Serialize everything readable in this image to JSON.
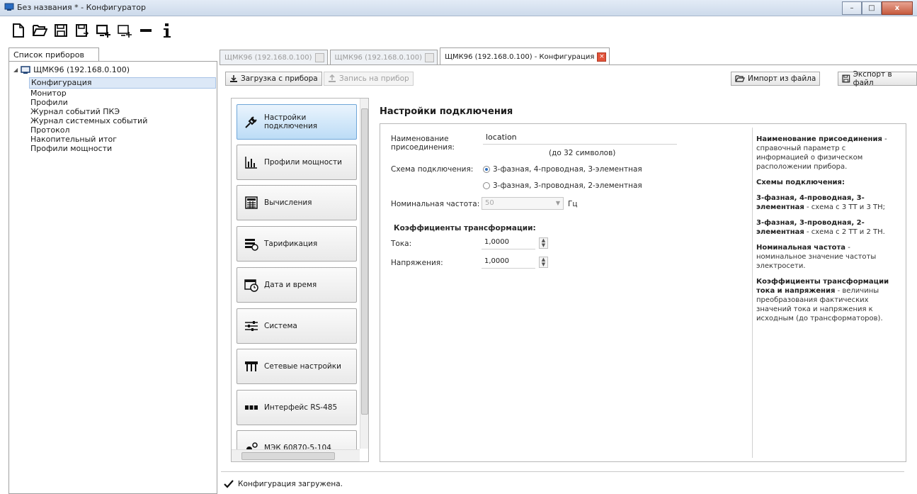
{
  "window": {
    "title": "Без названия * - Конфигуратор",
    "minimize": "–",
    "maximize": "□",
    "close": "x"
  },
  "toolbar": {
    "icons": [
      "new-file-icon",
      "open-folder-icon",
      "save-icon",
      "save-as-icon",
      "add-device-icon",
      "add-device-copy-icon",
      "remove-icon",
      "info-icon"
    ]
  },
  "left": {
    "tab_label": "Список приборов",
    "root_label": "ЩМК96 (192.168.0.100)",
    "items": [
      "Конфигурация",
      "Монитор",
      "Профили",
      "Журнал событий ПКЭ",
      "Журнал системных событий",
      "Протокол",
      "Накопительный итог",
      "Профили мощности"
    ]
  },
  "tabs": [
    {
      "label": "ЩМК96 (192.168.0.100)"
    },
    {
      "label": "ЩМК96 (192.168.0.100)"
    },
    {
      "label": "ЩМК96 (192.168.0.100) - Конфигурация"
    }
  ],
  "actions": {
    "load": "Загрузка с прибора",
    "write": "Запись на прибор",
    "import": "Импорт из файла",
    "export": "Экспорт в файл"
  },
  "categories": [
    {
      "label": "Настройки\nподключения",
      "icon": "plug-icon"
    },
    {
      "label": "Профили мощности",
      "icon": "bar-chart-icon"
    },
    {
      "label": "Вычисления",
      "icon": "calculator-icon"
    },
    {
      "label": "Тарификация",
      "icon": "tariff-icon"
    },
    {
      "label": "Дата и время",
      "icon": "calendar-clock-icon"
    },
    {
      "label": "Система",
      "icon": "sliders-icon"
    },
    {
      "label": "Сетевые настройки",
      "icon": "network-icon"
    },
    {
      "label": "Интерфейс RS-485",
      "icon": "rs485-icon"
    },
    {
      "label": "МЭК 60870-5-104",
      "icon": "iec-icon"
    }
  ],
  "settings": {
    "title": "Настройки подключения",
    "name_label": "Наименование присоединения:",
    "name_value": "location",
    "name_hint": "(до 32 символов)",
    "scheme_label": "Схема подключения:",
    "scheme_option1": "3-фазная, 4-проводная, 3-элементная",
    "scheme_option2": "3-фазная, 3-проводная, 2-элементная",
    "freq_label": "Номинальная частота:",
    "freq_value": "50",
    "freq_unit": "Гц",
    "coef_title": "Коэффициенты трансформации:",
    "current_label": "Тока:",
    "current_value": "1,0000",
    "voltage_label": "Напряжения:",
    "voltage_value": "1,0000"
  },
  "help": {
    "p1_bold": "Наименование присоединения",
    "p1_text": " - справочный параметр с информацией о физическом расположении прибора.",
    "p2_bold": "Схемы подключения:",
    "p3_bold": "3-фазная, 4-проводная, 3-элементная",
    "p3_text": " - схема с 3 ТТ и 3 ТН;",
    "p4_bold": "3-фазная, 3-проводная, 2-элементная",
    "p4_text": " - схема с 2 ТТ и 2 ТН.",
    "p5_bold": "Номинальная частота",
    "p5_text": " - номинальное значение частоты электросети.",
    "p6_bold": "Коэффициенты трансформации тока и напряжения",
    "p6_text": " - величины преобразования фактических значений тока и напряжения к исходным (до трансформаторов)."
  },
  "status": {
    "text": "Конфигурация загружена."
  },
  "colors": {
    "accent": "#2f6fbf",
    "close_red": "#e2533a"
  }
}
